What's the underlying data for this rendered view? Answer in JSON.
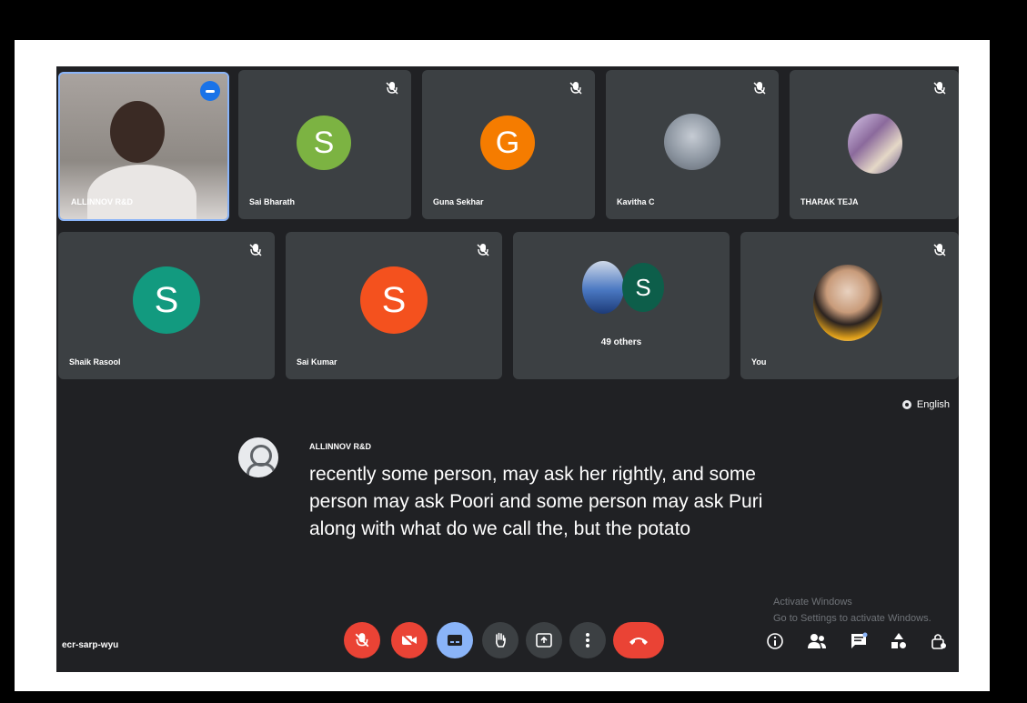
{
  "participants_row1": [
    {
      "name": "ALLINNOV R&D",
      "type": "video"
    },
    {
      "name": "Sai Bharath",
      "initial": "S",
      "color": "#7cb342"
    },
    {
      "name": "Guna Sekhar",
      "initial": "G",
      "color": "#f57c00"
    },
    {
      "name": "Kavitha C",
      "type": "photo"
    },
    {
      "name": "THARAK TEJA",
      "type": "photo"
    }
  ],
  "participants_row2": [
    {
      "name": "Shaik Rasool",
      "initial": "S",
      "color": "#129a7f"
    },
    {
      "name": "Sai Kumar",
      "initial": "S",
      "color": "#f4511e"
    },
    {
      "name": "49 others",
      "initial": "S",
      "color": "#0d5e4a"
    },
    {
      "name": "You",
      "type": "photo"
    }
  ],
  "caption": {
    "speaker": "ALLINNOV R&D",
    "text": "recently some person, may ask her rightly, and some person may ask Poori and some person may ask Puri along with what do we call the, but the potato"
  },
  "language": "English",
  "meeting_code": "ecr-sarp-wyu",
  "watermark": {
    "line1": "Activate Windows",
    "line2": "Go to Settings to activate Windows."
  },
  "controls": [
    "mic-off",
    "camera-off",
    "captions",
    "raise-hand",
    "present",
    "more-options",
    "end-call"
  ],
  "right_controls": [
    "meeting-details",
    "people",
    "chat",
    "activities",
    "host-controls"
  ],
  "colors": {
    "background": "#202124",
    "tile": "#3c4043",
    "red": "#ea4335",
    "blue_selected": "#8ab4f8"
  }
}
